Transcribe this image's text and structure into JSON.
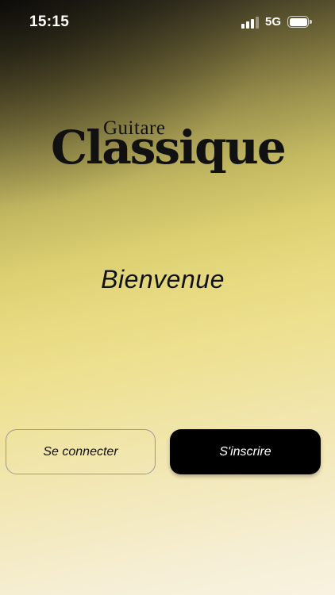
{
  "status_bar": {
    "time": "15:15",
    "network": "5G",
    "signal_icon": "cellular-signal-icon",
    "battery_icon": "battery-icon",
    "signal_bars_active": 3,
    "signal_bars_total": 4
  },
  "logo": {
    "top_word": "Guitare",
    "main_word": "Classique"
  },
  "welcome": {
    "text": "Bienvenue"
  },
  "actions": {
    "login_label": "Se connecter",
    "signup_label": "S'inscrire"
  },
  "colors": {
    "background_top": "#1c1a14",
    "background_mid": "#e7da81",
    "background_bottom": "#f8f2e0",
    "primary_button": "#000000",
    "text": "#111111"
  }
}
